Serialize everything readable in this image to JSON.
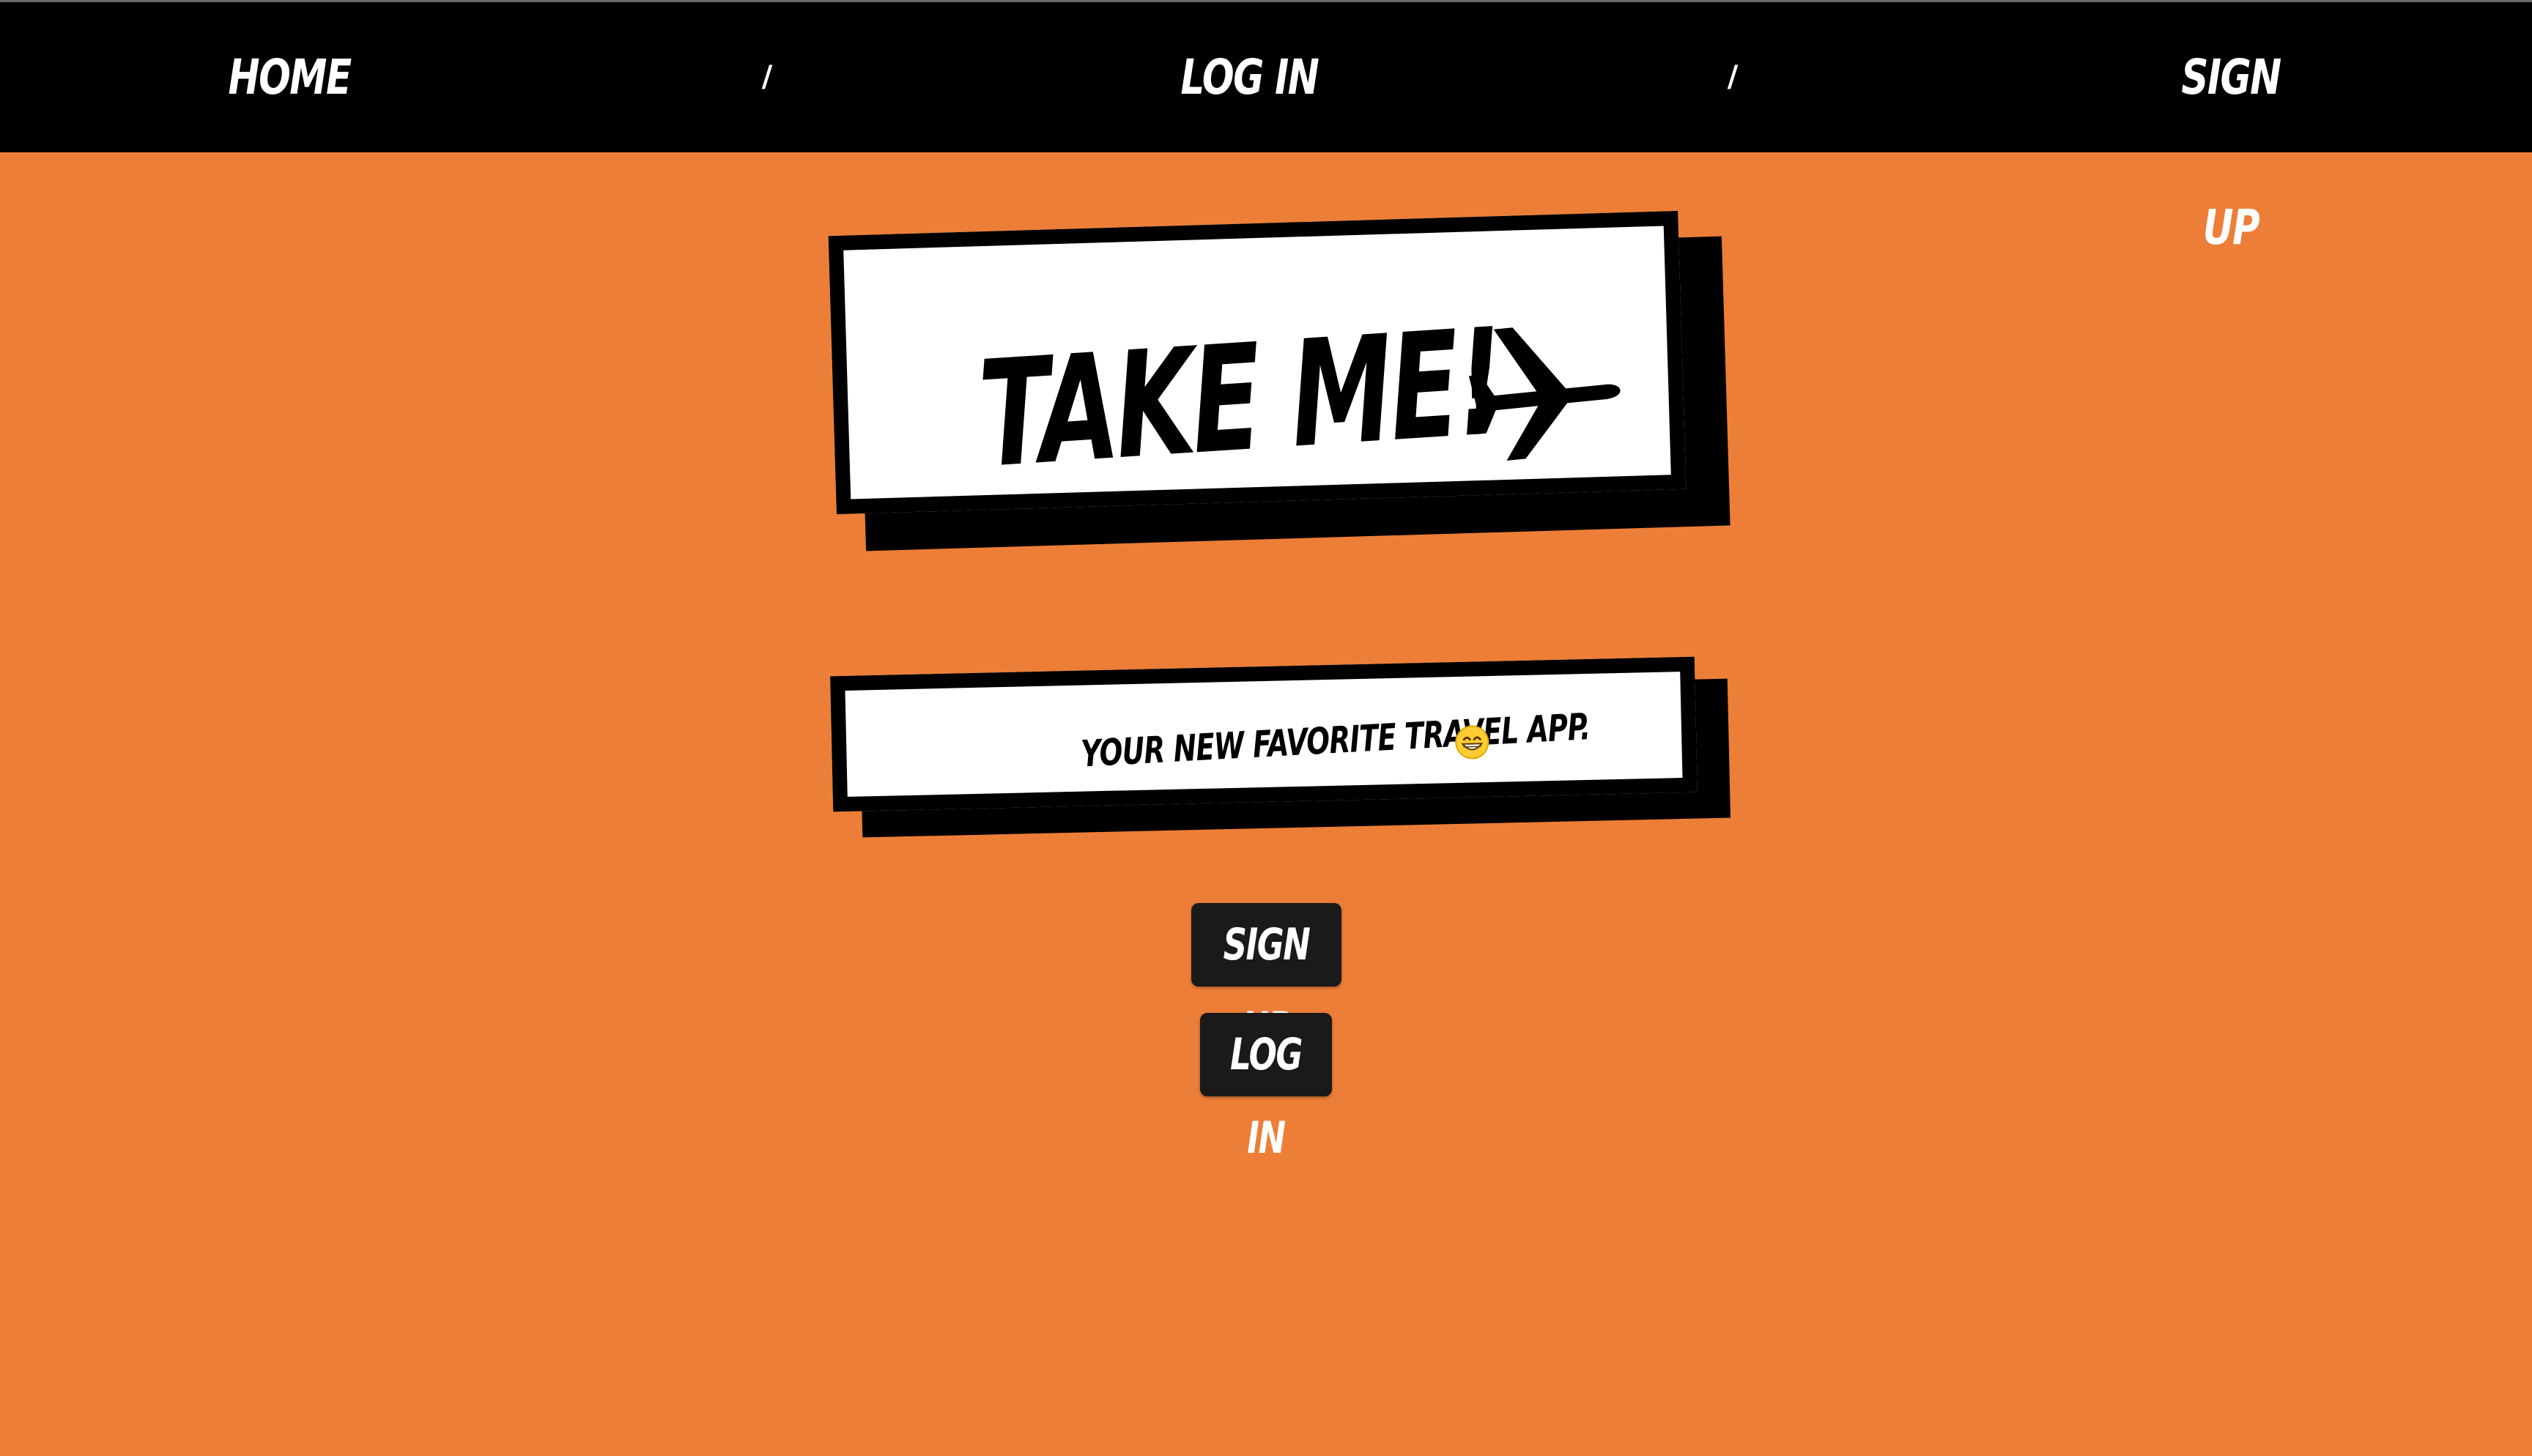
{
  "nav": {
    "home": "Home",
    "login": "Log in",
    "signup": "Sign up",
    "separator": "/"
  },
  "hero": {
    "title": "Take me!",
    "title_icon": "airplane-icon",
    "subtitle": "Your new favorite travel app.",
    "subtitle_icon": "grinning-face-emoji-icon"
  },
  "buttons": {
    "signup": "Sign up",
    "login": "Log in"
  },
  "colors": {
    "background": "#ED7E37",
    "navbar": "#000000",
    "panel": "#FFFFFF",
    "button": "#1A1A1A"
  }
}
